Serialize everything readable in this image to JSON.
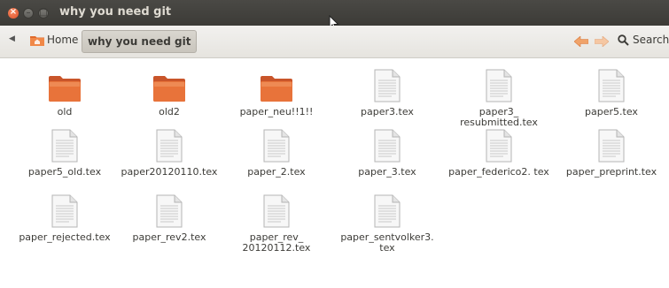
{
  "window": {
    "title": "why you need git"
  },
  "toolbar": {
    "home_label": "Home",
    "current_folder": "why you need git",
    "search_label": "Search"
  },
  "items": [
    {
      "name": "old",
      "type": "folder"
    },
    {
      "name": "old2",
      "type": "folder"
    },
    {
      "name": "paper_neu!!1!!",
      "type": "folder"
    },
    {
      "name": "paper3.tex",
      "type": "file"
    },
    {
      "name": "paper3_ resubmitted.tex",
      "type": "file"
    },
    {
      "name": "paper5.tex",
      "type": "file"
    },
    {
      "name": "paper5_old.tex",
      "type": "file"
    },
    {
      "name": "paper20120110.tex",
      "type": "file"
    },
    {
      "name": "paper_2.tex",
      "type": "file"
    },
    {
      "name": "paper_3.tex",
      "type": "file"
    },
    {
      "name": "paper_federico2. tex",
      "type": "file"
    },
    {
      "name": "paper_preprint.tex",
      "type": "file"
    },
    {
      "name": "paper_rejected.tex",
      "type": "file"
    },
    {
      "name": "paper_rev2.tex",
      "type": "file"
    },
    {
      "name": "paper_rev_ 20120112.tex",
      "type": "file"
    },
    {
      "name": "paper_sentvolker3. tex",
      "type": "file"
    }
  ],
  "icons": {
    "close": "close-icon",
    "minimize": "minimize-icon",
    "maximize": "maximize-icon",
    "back": "back-icon",
    "home": "home-folder-icon",
    "nav_back": "arrow-left-icon",
    "nav_forward": "arrow-right-icon",
    "search": "search-icon",
    "folder": "folder-icon",
    "file": "text-file-icon"
  },
  "colors": {
    "titlebar": "#3c3b37",
    "close_button": "#e0512a",
    "folder": "#e8733a",
    "nav_arrow": "#f0a36a"
  }
}
